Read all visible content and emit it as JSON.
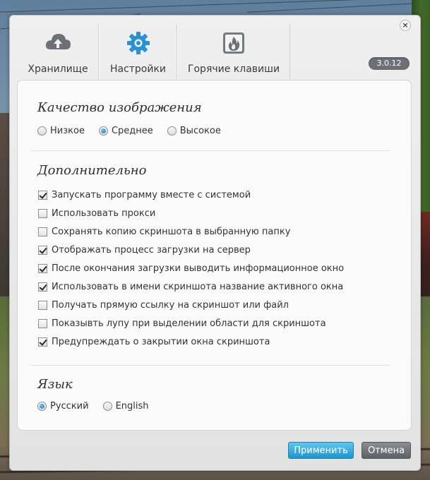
{
  "window": {
    "version": "3.0.12",
    "close_glyph": "×"
  },
  "tabs": [
    {
      "label": "Хранилище",
      "icon": "cloud-upload-icon"
    },
    {
      "label": "Настройки",
      "icon": "gear-icon"
    },
    {
      "label": "Горячие клавиши",
      "icon": "fire-icon"
    }
  ],
  "quality": {
    "title": "Качество изображения",
    "options": [
      {
        "label": "Низкое",
        "selected": false
      },
      {
        "label": "Среднее",
        "selected": true
      },
      {
        "label": "Высокое",
        "selected": false
      }
    ]
  },
  "additional": {
    "title": "Дополнительно",
    "options": [
      {
        "label": "Запускать программу вместе с системой",
        "checked": true
      },
      {
        "label": "Использовать прокси",
        "checked": false
      },
      {
        "label": "Сохранять копию скриншота в выбранную папку",
        "checked": false
      },
      {
        "label": "Отображать процесс загрузки на сервер",
        "checked": true
      },
      {
        "label": "После окончания загрузки выводить информационное окно",
        "checked": true
      },
      {
        "label": "Использовать в имени скриншота название активного окна",
        "checked": true
      },
      {
        "label": "Получать прямую ссылку на скриншот или файл",
        "checked": false
      },
      {
        "label": "Показывть лупу при выделении области для скриншота",
        "checked": false
      },
      {
        "label": "Предупреждать о закрытии окна скриншота",
        "checked": true
      }
    ]
  },
  "language": {
    "title": "Язык",
    "options": [
      {
        "label": "Русский",
        "selected": true
      },
      {
        "label": "English",
        "selected": false
      }
    ]
  },
  "buttons": {
    "apply": "Применить",
    "cancel": "Отмена"
  },
  "colors": {
    "accent": "#1e94c9",
    "radio_selected": "#1f7bc2",
    "cancel_button": "#5d6165",
    "version_badge": "#6c7176"
  }
}
